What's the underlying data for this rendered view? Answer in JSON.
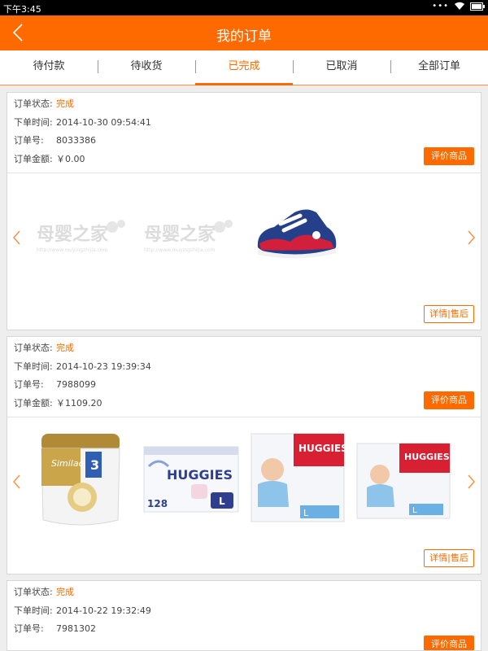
{
  "statusbar": {
    "time": "下午3:45"
  },
  "header": {
    "title": "我的订单"
  },
  "tabs": [
    "待付款",
    "待收货",
    "已完成",
    "已取消",
    "全部订单"
  ],
  "active_tab": 2,
  "orders": [
    {
      "status_label": "订单状态:",
      "status": "完成",
      "time_label": "下单时间:",
      "time": "2014-10-30 09:54:41",
      "no_label": "订单号:",
      "no": "8033386",
      "amount_label": "订单金额:",
      "amount": "￥0.00",
      "review_button": "评价商品",
      "after_sale_button": "详情|售后",
      "products": [
        {
          "name": "母婴之家 watermark placeholder",
          "watermark": "母婴之家",
          "watermark_url": "http://www.muyingzhijia.com"
        },
        {
          "name": "母婴之家 watermark placeholder",
          "watermark": "母婴之家",
          "watermark_url": "http://www.muyingzhijia.com"
        },
        {
          "name": "baby sneaker"
        }
      ]
    },
    {
      "status_label": "订单状态:",
      "status": "完成",
      "time_label": "下单时间:",
      "time": "2014-10-23 19:39:34",
      "no_label": "订单号:",
      "no": "7988099",
      "amount_label": "订单金额:",
      "amount": "￥1109.20",
      "review_button": "评价商品",
      "after_sale_button": "详情|售后",
      "products": [
        {
          "name": "Similac milk formula can",
          "brand": "Similac"
        },
        {
          "name": "Huggies diapers pack",
          "brand": "HUGGIES",
          "count": "128",
          "size": "L"
        },
        {
          "name": "Huggies growing pants L",
          "brand": "HUGGIES",
          "size": "L"
        },
        {
          "name": "Huggies growing pants L",
          "brand": "HUGGIES",
          "size": "L"
        }
      ]
    },
    {
      "status_label": "订单状态:",
      "status": "完成",
      "time_label": "下单时间:",
      "time": "2014-10-22 19:32:49",
      "no_label": "订单号:",
      "no": "7981302",
      "review_button": "评价商品"
    }
  ],
  "colors": {
    "accent": "#ff6a00",
    "statusbar": "#000000",
    "page_bg": "#eeeeee"
  },
  "icons": [
    "back-icon",
    "wifi-icon",
    "battery-icon",
    "chevron-left-icon",
    "chevron-right-icon"
  ]
}
